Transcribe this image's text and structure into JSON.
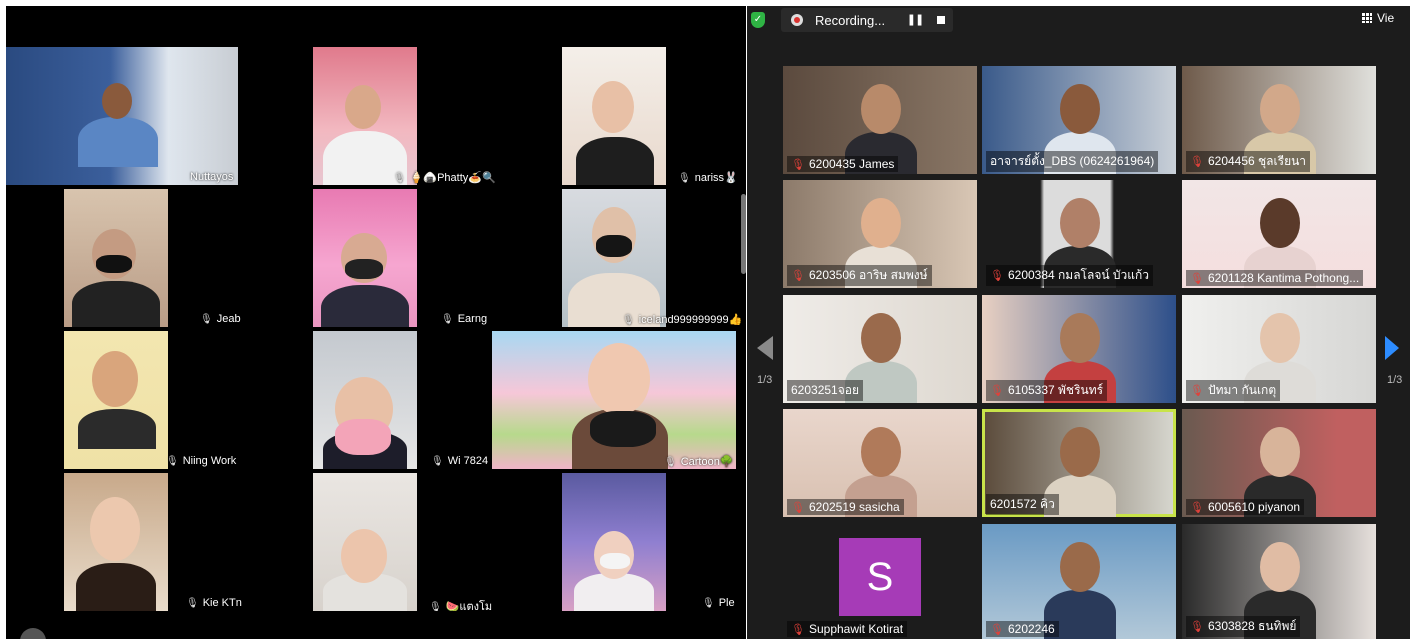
{
  "colors": {
    "recording_red": "#d9322f",
    "shield_green": "#2fb344",
    "active_speaker": "#c8e34a",
    "nav_blue": "#2d8cff",
    "avatar_purple": "#a63bb7"
  },
  "recording": {
    "label": "Recording..."
  },
  "view_button": {
    "label": "Vie"
  },
  "pagination": {
    "left": "1/3",
    "right": "1/3"
  },
  "left_gallery": [
    {
      "name": "Nuttayos",
      "mic": "none"
    },
    {
      "name": "🍦🍙Phatty🍝🔍",
      "mic": "muted"
    },
    {
      "name": "nariss🐰",
      "mic": "muted"
    },
    {
      "name": "Jeab",
      "mic": "muted"
    },
    {
      "name": "Earng",
      "mic": "muted"
    },
    {
      "name": "iceland999999999👍",
      "mic": "muted"
    },
    {
      "name": "Niing Work",
      "mic": "muted"
    },
    {
      "name": "Wi 7824",
      "mic": "muted"
    },
    {
      "name": "Cartoon🌳",
      "mic": "muted"
    },
    {
      "name": "Kie KTn",
      "mic": "muted"
    },
    {
      "name": "🍉แตงโม",
      "mic": "muted"
    },
    {
      "name": "Ple",
      "mic": "muted"
    }
  ],
  "right_gallery": [
    {
      "name": "6200435 James",
      "muted": true
    },
    {
      "name": "อาจารย์ตั้ง_DBS (0624261964)",
      "muted": false
    },
    {
      "name": "6204456 ชุลเรียนา",
      "muted": true
    },
    {
      "name": "6203506 อาริษ สมพงษ์",
      "muted": true
    },
    {
      "name": "6200384 กมลโลจน์ บัวแก้ว",
      "muted": true
    },
    {
      "name": "6201128 Kantima Pothong...",
      "muted": true
    },
    {
      "name": "6203251จอย",
      "muted": false
    },
    {
      "name": "6105337 พัชรินทร์",
      "muted": true
    },
    {
      "name": "ปัทมา กันเกตุ",
      "muted": true
    },
    {
      "name": "6202519 sasicha",
      "muted": true
    },
    {
      "name": "6201572 คิว",
      "muted": false
    },
    {
      "name": "6005610 piyanon",
      "muted": true
    },
    {
      "name": "Supphawit Kotirat",
      "muted": true,
      "avatar_letter": "S"
    },
    {
      "name": "6202246",
      "muted": true
    },
    {
      "name": "6303828 ธนทิพย์",
      "muted": true
    }
  ]
}
